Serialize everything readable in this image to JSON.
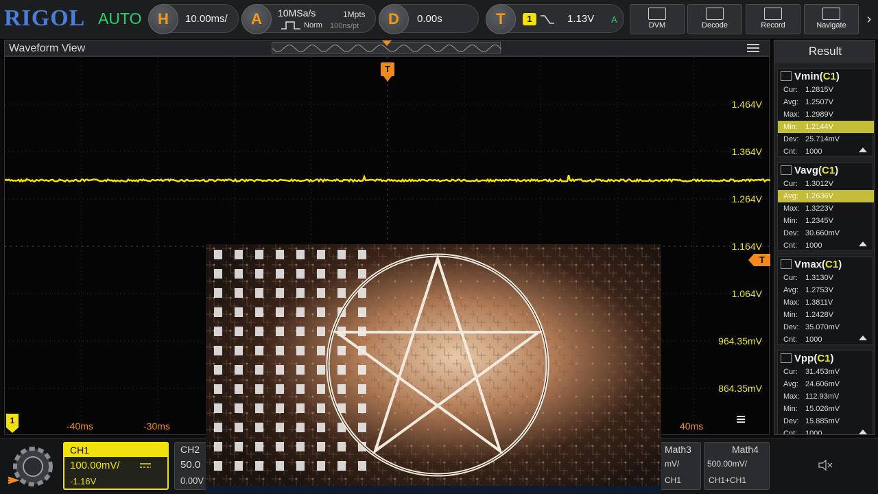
{
  "topbar": {
    "logo": "RIGOL",
    "mode": "AUTO",
    "horizontal": {
      "badge": "H",
      "value": "10.00ms/"
    },
    "acquire": {
      "badge": "A",
      "rate": "10MSa/s",
      "points": "1Mpts",
      "type": "Norm",
      "time_per_pt": "100ns/pt"
    },
    "delay": {
      "badge": "D",
      "value": "0.00s"
    },
    "trigger": {
      "badge": "T",
      "source": "1",
      "level": "1.13V",
      "status": "A"
    },
    "tools": [
      {
        "label": "DVM"
      },
      {
        "label": "Decode"
      },
      {
        "label": "Record"
      },
      {
        "label": "Navigate"
      }
    ]
  },
  "waveform": {
    "title": "Waveform View",
    "trigger_marker": "T",
    "ch1_marker": "1",
    "voltage_labels": [
      "1.464V",
      "1.364V",
      "1.264V",
      "1.164V",
      "1.064V",
      "964.35mV",
      "864.35mV"
    ],
    "time_labels": [
      "-40ms",
      "-30ms",
      "40ms"
    ]
  },
  "result": {
    "title": "Result",
    "cards": [
      {
        "name": "Vmin",
        "channel": "C1",
        "rows": [
          {
            "k": "Cur:",
            "v": "1.2815V"
          },
          {
            "k": "Avg:",
            "v": "1.2507V"
          },
          {
            "k": "Max:",
            "v": "1.2989V"
          },
          {
            "k": "Min:",
            "v": "1.2144V"
          },
          {
            "k": "Dev:",
            "v": "25.714mV"
          },
          {
            "k": "Cnt:",
            "v": "1000"
          }
        ]
      },
      {
        "name": "Vavg",
        "channel": "C1",
        "rows": [
          {
            "k": "Cur:",
            "v": "1.3012V"
          },
          {
            "k": "Avg:",
            "v": "1.2636V"
          },
          {
            "k": "Max:",
            "v": "1.3223V"
          },
          {
            "k": "Min:",
            "v": "1.2345V"
          },
          {
            "k": "Dev:",
            "v": "30.660mV"
          },
          {
            "k": "Cnt:",
            "v": "1000"
          }
        ]
      },
      {
        "name": "Vmax",
        "channel": "C1",
        "rows": [
          {
            "k": "Cur:",
            "v": "1.3130V"
          },
          {
            "k": "Avg:",
            "v": "1.2753V"
          },
          {
            "k": "Max:",
            "v": "1.3811V"
          },
          {
            "k": "Min:",
            "v": "1.2428V"
          },
          {
            "k": "Dev:",
            "v": "35.070mV"
          },
          {
            "k": "Cnt:",
            "v": "1000"
          }
        ]
      },
      {
        "name": "Vpp",
        "channel": "C1",
        "rows": [
          {
            "k": "Cur:",
            "v": "31.453mV"
          },
          {
            "k": "Avg:",
            "v": "24.606mV"
          },
          {
            "k": "Max:",
            "v": "112.93mV"
          },
          {
            "k": "Min:",
            "v": "15.026mV"
          },
          {
            "k": "Dev:",
            "v": "15.885mV"
          },
          {
            "k": "Cnt:",
            "v": "1000"
          }
        ]
      }
    ]
  },
  "bottom": {
    "ch1": {
      "name": "CH1",
      "scale": "100.00mV/",
      "offset": "-1.16V"
    },
    "ch2": {
      "name": "CH2",
      "scale": "50.0",
      "offset": "0.00V"
    },
    "math3": {
      "name": "Math3",
      "scale": "mV/",
      "source": "CH1"
    },
    "math4": {
      "name": "Math4",
      "scale": "500.00mV/",
      "source": "CH1+CH1"
    }
  },
  "colors": {
    "ch1": "#f2e10c",
    "trigger": "#f08a1e",
    "rigol_blue": "#4a7fd9",
    "auto_green": "#26d26e"
  }
}
